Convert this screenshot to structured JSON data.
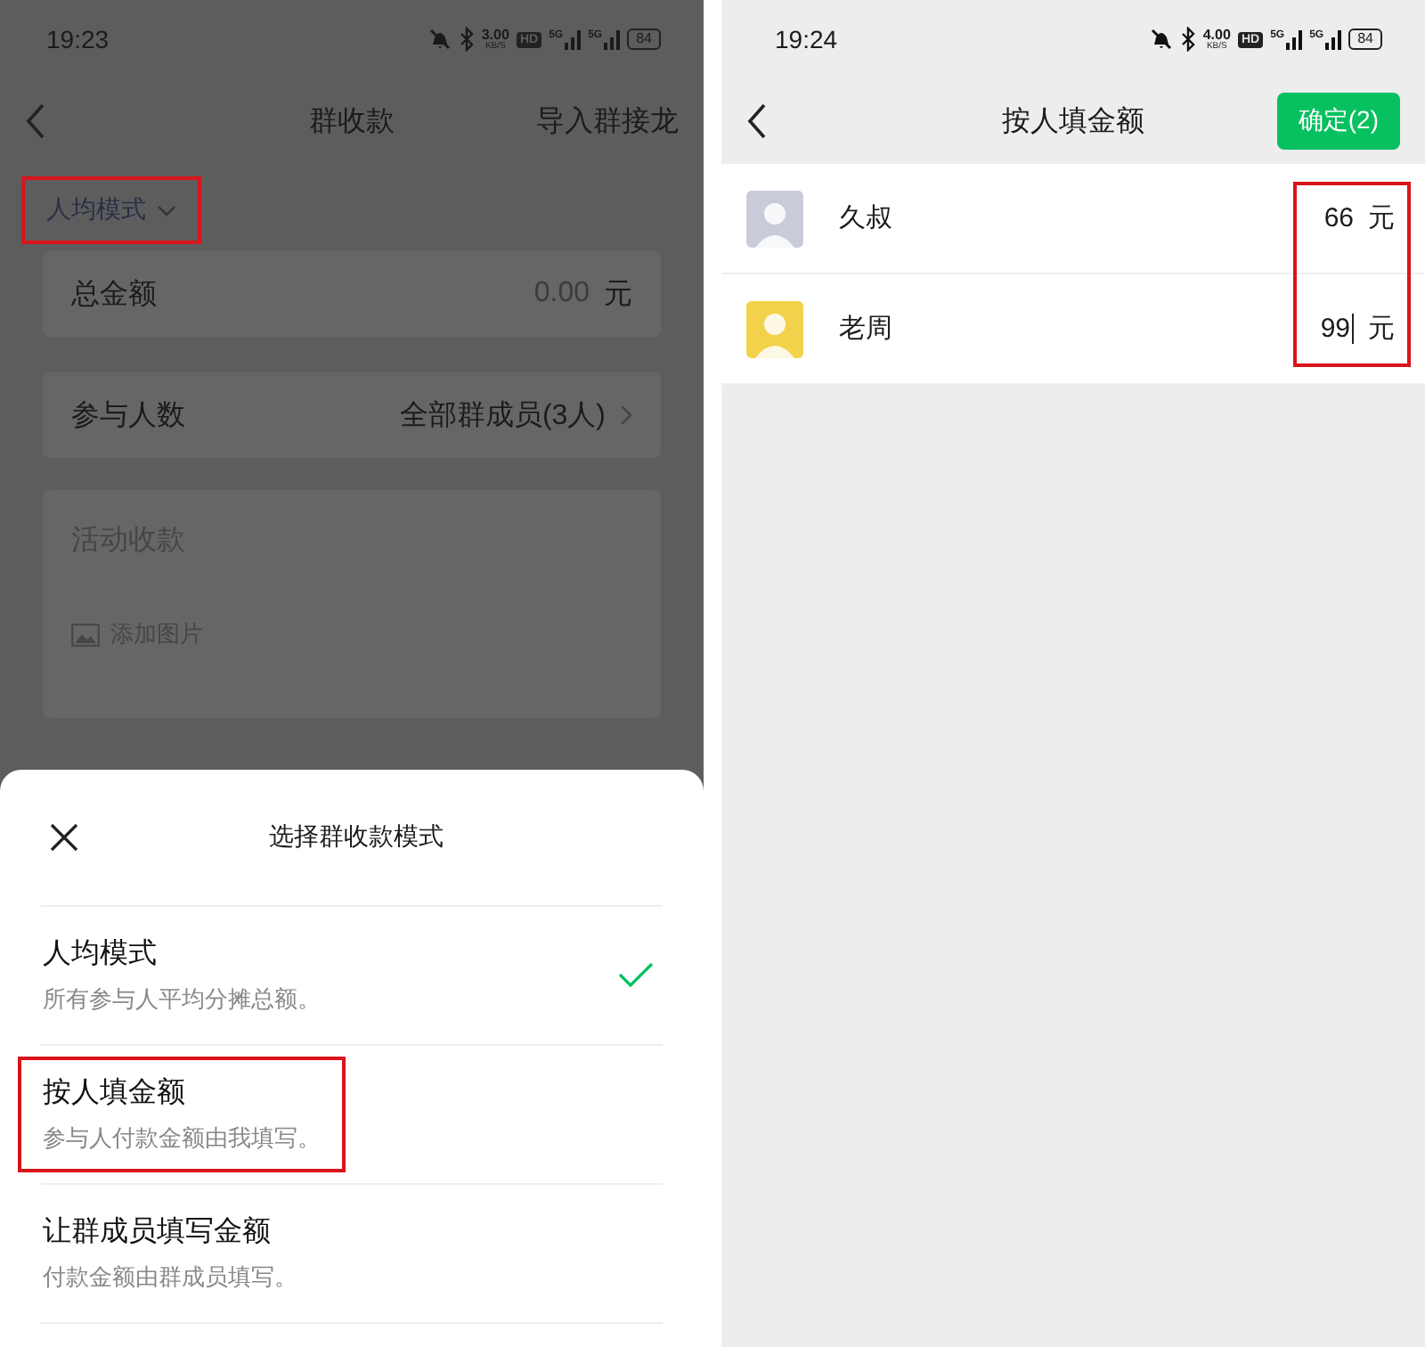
{
  "left_screen": {
    "status_bar": {
      "time": "19:23",
      "speed": "3.00",
      "speed_unit": "KB/S",
      "hd": "HD",
      "network": [
        "5G",
        "5G"
      ],
      "battery": "84"
    },
    "nav": {
      "title": "群收款",
      "action": "导入群接龙"
    },
    "mode_selector": {
      "label": "人均模式",
      "highlighted": true
    },
    "total_card": {
      "label": "总金额",
      "value": "0.00",
      "unit": "元"
    },
    "participants_card": {
      "label": "参与人数",
      "value": "全部群成员(3人)"
    },
    "activity_card": {
      "placeholder": "活动收款",
      "add_image": "添加图片"
    },
    "sheet": {
      "title": "选择群收款模式",
      "options": [
        {
          "title": "人均模式",
          "description": "所有参与人平均分摊总额。",
          "selected": true,
          "highlighted": false
        },
        {
          "title": "按人填金额",
          "description": "参与人付款金额由我填写。",
          "selected": false,
          "highlighted": true
        },
        {
          "title": "让群成员填写金额",
          "description": "付款金额由群成员填写。",
          "selected": false,
          "highlighted": false
        }
      ]
    }
  },
  "right_screen": {
    "status_bar": {
      "time": "19:24",
      "speed": "4.00",
      "speed_unit": "KB/S",
      "hd": "HD",
      "network": [
        "5G",
        "5G"
      ],
      "battery": "84"
    },
    "nav": {
      "title": "按人填金额",
      "confirm": "确定(2)"
    },
    "amounts_highlighted": true,
    "members": [
      {
        "name": "久叔",
        "amount": "66",
        "unit": "元",
        "focused": false,
        "color": "#c9ccd8"
      },
      {
        "name": "老周",
        "amount": "99",
        "unit": "元",
        "focused": true,
        "color": "#f2d24a"
      }
    ]
  }
}
